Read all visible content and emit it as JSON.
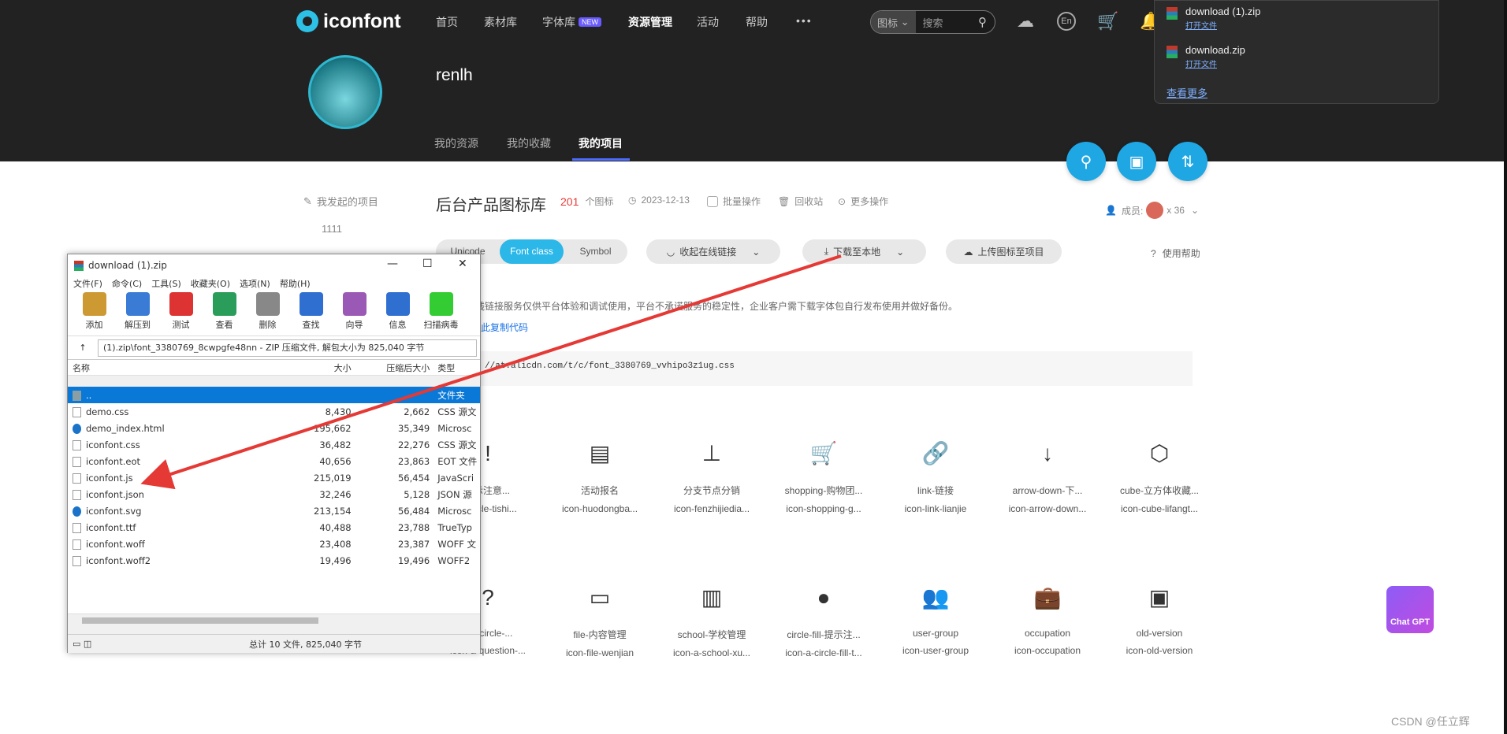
{
  "app": {
    "logo_text": "iconfont",
    "nav": [
      "首页",
      "素材库",
      "字体库",
      "资源管理",
      "活动",
      "帮助",
      "•••"
    ],
    "nav_badge": "NEW",
    "search_scope": "图标",
    "search_placeholder": "搜索",
    "lang_button": "En"
  },
  "downloads": {
    "items": [
      {
        "name": "download (1).zip",
        "action": "打开文件"
      },
      {
        "name": "download.zip",
        "action": "打开文件"
      }
    ],
    "more": "查看更多"
  },
  "profile": {
    "username": "renlh",
    "tabs": [
      "我的资源",
      "我的收藏",
      "我的项目"
    ],
    "active_tab": "我的项目"
  },
  "sidebar": {
    "heading": "我发起的项目",
    "item": "1111"
  },
  "project": {
    "title": "后台产品图标库",
    "count": "201",
    "count_unit": "个图标",
    "date": "2023-12-13",
    "batch": "批量操作",
    "trash": "回收站",
    "more_ops": "更多操作",
    "members_label": "成员:",
    "members_count": "x 36",
    "format_tabs": [
      "Unicode",
      "Font class",
      "Symbol"
    ],
    "active_format": "Font class",
    "online_link": "收起在线链接",
    "download": "下载至本地",
    "upload": "上传图标至项目",
    "help": "使用帮助",
    "notice": "线链接服务仅供平台体验和调试使用，平台不承诺服务的稳定性，企业客户需下载字体包自行发布使用并做好备份。",
    "copy_code": "此复制代码",
    "css_url": "//at.alicdn.com/t/c/font_3380769_vvhipo3z1ug.css"
  },
  "icons_row1": [
    {
      "glyph": "!",
      "name": "...示注意...",
      "cls": "...circle-tishi..."
    },
    {
      "glyph": "▤",
      "name": "活动报名",
      "cls": "icon-huodongba..."
    },
    {
      "glyph": "⊥",
      "name": "分支节点分销",
      "cls": "icon-fenzhijiedia..."
    },
    {
      "glyph": "🛒",
      "name": "shopping-购物团...",
      "cls": "icon-shopping-g..."
    },
    {
      "glyph": "🔗",
      "name": "link-链接",
      "cls": "icon-link-lianjie"
    },
    {
      "glyph": "↓",
      "name": "arrow-down-下...",
      "cls": "icon-arrow-down..."
    },
    {
      "glyph": "⬡",
      "name": "cube-立方体收藏...",
      "cls": "icon-cube-lifangt..."
    }
  ],
  "icons_row2": [
    {
      "glyph": "?",
      "name": "...n-circle-...",
      "cls": "icon-a-question-..."
    },
    {
      "glyph": "▭",
      "name": "file-内容管理",
      "cls": "icon-file-wenjian"
    },
    {
      "glyph": "▥",
      "name": "school-学校管理",
      "cls": "icon-a-school-xu..."
    },
    {
      "glyph": "●",
      "name": "circle-fill-提示注...",
      "cls": "icon-a-circle-fill-t..."
    },
    {
      "glyph": "👥",
      "name": "user-group",
      "cls": "icon-user-group"
    },
    {
      "glyph": "💼",
      "name": "occupation",
      "cls": "icon-occupation"
    },
    {
      "glyph": "▣",
      "name": "old-version",
      "cls": "icon-old-version"
    }
  ],
  "chat_gpt": "Chat GPT",
  "watermark": "CSDN @任立辉",
  "winrar": {
    "title": "download (1).zip",
    "menu": [
      "文件(F)",
      "命令(C)",
      "工具(S)",
      "收藏夹(O)",
      "选项(N)",
      "帮助(H)"
    ],
    "toolbar": [
      "添加",
      "解压到",
      "测试",
      "查看",
      "删除",
      "查找",
      "向导",
      "信息",
      "扫描病毒"
    ],
    "path": "(1).zip\\font_3380769_8cwpgfe48nn - ZIP 压缩文件, 解包大小为 825,040 字节",
    "columns": [
      "名称",
      "大小",
      "压缩后大小",
      "类型"
    ],
    "rows": [
      {
        "name": "..",
        "size": "",
        "psize": "",
        "type": "文件夹",
        "icon": "folder"
      },
      {
        "name": "demo.css",
        "size": "8,430",
        "psize": "2,662",
        "type": "CSS 源文",
        "icon": "file"
      },
      {
        "name": "demo_index.html",
        "size": "195,662",
        "psize": "35,349",
        "type": "Microsc",
        "icon": "edge"
      },
      {
        "name": "iconfont.css",
        "size": "36,482",
        "psize": "22,276",
        "type": "CSS 源文",
        "icon": "file"
      },
      {
        "name": "iconfont.eot",
        "size": "40,656",
        "psize": "23,863",
        "type": "EOT 文件",
        "icon": "file"
      },
      {
        "name": "iconfont.js",
        "size": "215,019",
        "psize": "56,454",
        "type": "JavaScri",
        "icon": "file"
      },
      {
        "name": "iconfont.json",
        "size": "32,246",
        "psize": "5,128",
        "type": "JSON 源",
        "icon": "file"
      },
      {
        "name": "iconfont.svg",
        "size": "213,154",
        "psize": "56,484",
        "type": "Microsc",
        "icon": "edge"
      },
      {
        "name": "iconfont.ttf",
        "size": "40,488",
        "psize": "23,788",
        "type": "TrueTyp",
        "icon": "file"
      },
      {
        "name": "iconfont.woff",
        "size": "23,408",
        "psize": "23,387",
        "type": "WOFF 文",
        "icon": "file"
      },
      {
        "name": "iconfont.woff2",
        "size": "19,496",
        "psize": "19,496",
        "type": "WOFF2",
        "icon": "file"
      }
    ],
    "status": "总计 10 文件, 825,040 字节"
  },
  "colors": {
    "header_bg": "#222222",
    "accent": "#2bb7e7",
    "selection": "#0a78d7",
    "arrow": "#e53935",
    "count": "#e53935"
  }
}
